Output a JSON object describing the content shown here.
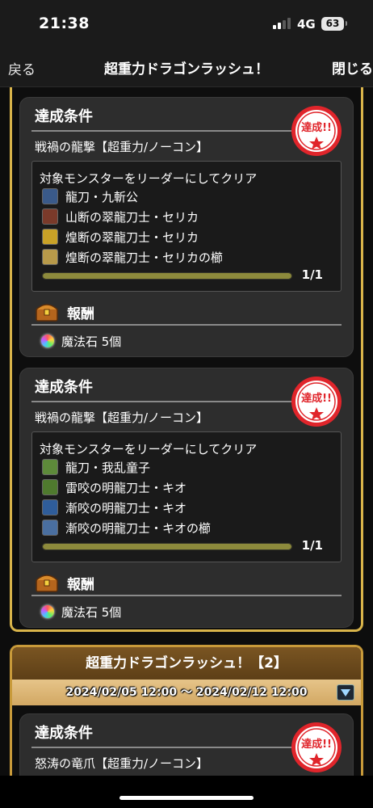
{
  "status_bar": {
    "time": "21:38",
    "network": "4G",
    "battery": "63"
  },
  "nav": {
    "back_label": "戻る",
    "title": "超重力ドラゴンラッシュ！",
    "close_label": "閉じる"
  },
  "colors": {
    "accent_gold": "#d9b44a",
    "stamp_red": "#e0252b",
    "progress": "#8d8a3c"
  },
  "missions": [
    {
      "header": "達成条件",
      "name": "戦禍の龍撃【超重力/ノーコン】",
      "stamp": "達成!!",
      "condition": "対象モンスターをリーダーにしてクリア",
      "monsters": [
        {
          "name": "龍刀・九斬公",
          "icon": "dark-dragon-icon",
          "color": "#3a5a8a"
        },
        {
          "name": "山断の翠龍刀士・セリカ",
          "icon": "wood-fire-icon",
          "color": "#7a3a2a"
        },
        {
          "name": "煌断の翠龍刀士・セリカ",
          "icon": "light-icon",
          "color": "#c9a227"
        },
        {
          "name": "煌断の翠龍刀士・セリカの櫛",
          "icon": "comb-icon",
          "color": "#b89a4a"
        }
      ],
      "progress": {
        "text": "1/1",
        "fraction": 1.0
      },
      "reward_title": "報酬",
      "reward_item": "魔法石 5個"
    },
    {
      "header": "達成条件",
      "name": "戦禍の龍撃【超重力/ノーコン】",
      "stamp": "達成!!",
      "condition": "対象モンスターをリーダーにしてクリア",
      "monsters": [
        {
          "name": "龍刀・我乱童子",
          "icon": "wood-dragon-icon",
          "color": "#5d8a3a"
        },
        {
          "name": "雷咬の明龍刀士・キオ",
          "icon": "wood-light-icon",
          "color": "#4f7a2e"
        },
        {
          "name": "漸咬の明龍刀士・キオ",
          "icon": "water-icon",
          "color": "#2f5d9a"
        },
        {
          "name": "漸咬の明龍刀士・キオの櫛",
          "icon": "comb-icon",
          "color": "#4a6fa0"
        }
      ],
      "progress": {
        "text": "1/1",
        "fraction": 1.0
      },
      "reward_title": "報酬",
      "reward_item": "魔法石 5個"
    },
    {
      "header": "達成条件",
      "name": "怒涛の竜爪【超重力/ノーコン】",
      "stamp": "達成!!"
    }
  ],
  "event2": {
    "title": "超重力ドラゴンラッシュ！【2】",
    "date_range": "2024/02/05 12:00 〜 2024/02/12 12:00"
  }
}
